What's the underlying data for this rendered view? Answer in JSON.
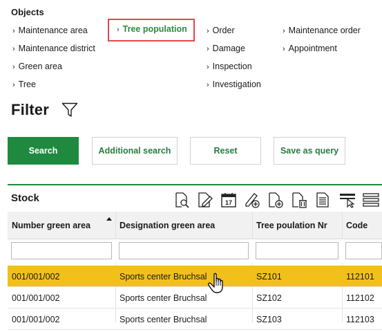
{
  "objects": {
    "title": "Objects",
    "links": [
      {
        "label": "Maintenance area"
      },
      {
        "label": "Maintenance district"
      },
      {
        "label": "Green area"
      },
      {
        "label": "Tree"
      },
      {
        "label": "Tree population",
        "active": true
      },
      {
        "label": "Order"
      },
      {
        "label": "Damage"
      },
      {
        "label": "Inspection"
      },
      {
        "label": "Investigation"
      },
      {
        "label": "Maintenance order"
      },
      {
        "label": "Appointment"
      }
    ]
  },
  "filter": {
    "title": "Filter",
    "icon": "funnel-icon",
    "buttons": {
      "search": "Search",
      "additional_search": "Additional search",
      "reset": "Reset",
      "save_as_query": "Save as query"
    }
  },
  "stock": {
    "title": "Stock",
    "toolbar_icons": [
      "view-document-icon",
      "edit-document-icon",
      "calendar-icon",
      "edit-add-icon",
      "new-document-icon",
      "delete-document-icon",
      "report-icon",
      "column-settings-icon",
      "menu-icon"
    ],
    "columns": [
      "Number green area",
      "Designation green area",
      "Tree poulation Nr",
      "Code"
    ],
    "sorted_column": "Number green area",
    "rows": [
      {
        "number": "001/001/002",
        "designation": "Sports center Bruchsal",
        "tree_nr": "SZ101",
        "code": "112101",
        "selected": true
      },
      {
        "number": "001/001/002",
        "designation": "Sports center Bruchsal",
        "tree_nr": "SZ102",
        "code": "112102"
      },
      {
        "number": "001/001/002",
        "designation": "Sports center Bruchsal",
        "tree_nr": "SZ103",
        "code": "112103"
      }
    ]
  },
  "colors": {
    "accent_green": "#1f8a3f",
    "selected_row": "#f2c01a",
    "highlight_border": "#e0474c"
  }
}
